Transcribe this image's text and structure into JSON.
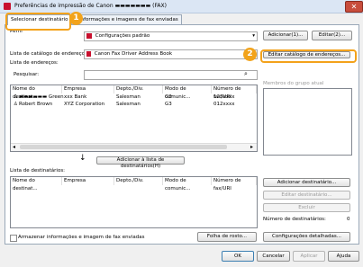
{
  "window": {
    "title": "Preferências de impressão de Canon ▬▬▬▬▬▬▬ (FAX)",
    "close_glyph": "✕"
  },
  "tabs": [
    {
      "label": "Selecionar destinatário"
    },
    {
      "label": "Informações e imagens de fax enviadas"
    }
  ],
  "badges": {
    "one": "1",
    "two": "2"
  },
  "profile": {
    "label": "Perfil",
    "value": "Configurações padrão",
    "add_button": "Adicionar(1)...",
    "edit_button": "Editar(2)..."
  },
  "address_book": {
    "list_label": "Lista de catálogo de endereços:",
    "list_value": "Canon Fax Driver Address Book",
    "edit_button": "Editar catálogo de endereços...",
    "addresses_label": "Lista de endereços:",
    "search_label": "Pesquisar:",
    "search_value": ""
  },
  "group_members_label": "Membros do grupo atual",
  "address_table": {
    "columns": [
      "Nome do destinat...",
      "Empresa",
      "Depto./Div.",
      "Modo de comunic...",
      "Número de fax/URI"
    ],
    "rows": [
      [
        "▬▬▬▬▬▬ Green",
        "xxx Bank",
        "Salesman",
        "G3",
        "123xxxx"
      ],
      [
        "Robert Brown",
        "XYZ Corporation",
        "Salesman",
        "G3",
        "012xxxx"
      ]
    ]
  },
  "add_to_list_button": "Adicionar à lista de destinatários(H)",
  "recipients": {
    "label": "Lista de destinatários:",
    "columns": [
      "Nome do destinat...",
      "Empresa",
      "Depto./Div.",
      "Modo de comunic...",
      "Número de fax/URI"
    ],
    "add_button": "Adicionar destinatário...",
    "edit_button": "Editar destinatário...",
    "delete_button": "Excluir",
    "count_label": "Número de destinatários:",
    "count_value": "0"
  },
  "store_checkbox_label": "Armazenar informações e imagem de fax enviadas",
  "cover_sheet_button": "Folha de rosto...",
  "detail_settings_button": "Configurações detalhadas...",
  "footer": {
    "ok": "OK",
    "cancel": "Cancelar",
    "apply": "Aplicar",
    "help": "Ajuda"
  },
  "colors": {
    "accent_orange": "#f2a31b",
    "titlebar": "#dbe6f4"
  }
}
